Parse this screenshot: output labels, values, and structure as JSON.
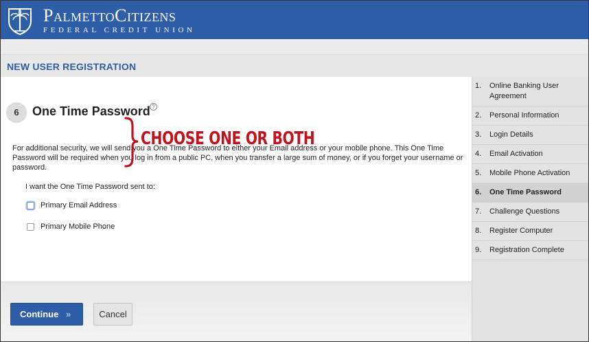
{
  "header": {
    "brand_name": "PalmettoCitizens",
    "brand_sub": "FEDERAL CREDIT UNION",
    "brand_color": "#2e5ea8"
  },
  "page": {
    "title": "NEW USER REGISTRATION"
  },
  "step": {
    "number": "6",
    "title": "One Time Password",
    "help_icon": "?",
    "description": "For additional security, we will send you a One Time Password to either your Email address or your mobile phone. This One Time Password will be required when you log in from a public PC, when you transfer a large sum of money, or if you forget your username or password.",
    "prompt": "I want the One Time Password sent to:",
    "options": [
      {
        "label": "Primary Email Address",
        "checked": false
      },
      {
        "label": "Primary Mobile Phone",
        "checked": false
      }
    ]
  },
  "annotation": {
    "text": "CHOOSE ONE OR BOTH",
    "color": "#c0131b"
  },
  "buttons": {
    "continue": "Continue",
    "continue_icon": "»",
    "cancel": "Cancel"
  },
  "sidebar": {
    "items": [
      {
        "num": "1.",
        "label": "Online Banking User Agreement"
      },
      {
        "num": "2.",
        "label": "Personal Information"
      },
      {
        "num": "3.",
        "label": "Login Details"
      },
      {
        "num": "4.",
        "label": "Email Activation"
      },
      {
        "num": "5.",
        "label": "Mobile Phone Activation"
      },
      {
        "num": "6.",
        "label": "One Time Password"
      },
      {
        "num": "7.",
        "label": "Challenge Questions"
      },
      {
        "num": "8.",
        "label": "Register Computer"
      },
      {
        "num": "9.",
        "label": "Registration Complete"
      }
    ],
    "active_index": 5
  }
}
